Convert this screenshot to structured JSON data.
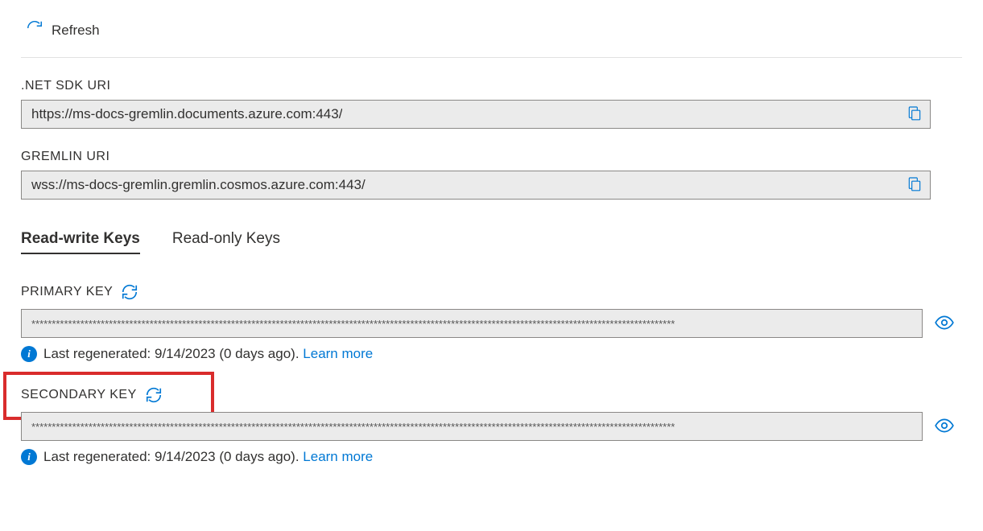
{
  "toolbar": {
    "refresh_label": "Refresh"
  },
  "uris": {
    "net_sdk": {
      "label": ".NET SDK URI",
      "value": "https://ms-docs-gremlin.documents.azure.com:443/"
    },
    "gremlin": {
      "label": "GREMLIN URI",
      "value": "wss://ms-docs-gremlin.gremlin.cosmos.azure.com:443/"
    }
  },
  "tabs": {
    "readwrite": "Read-write Keys",
    "readonly": "Read-only Keys"
  },
  "keys": {
    "primary": {
      "label": "PRIMARY KEY",
      "masked": "**************************************************************************************************************************************************************",
      "info_prefix": "Last regenerated: ",
      "info_date": "9/14/2023 (0 days ago). ",
      "learn_more": "Learn more"
    },
    "secondary": {
      "label": "SECONDARY KEY",
      "masked": "**************************************************************************************************************************************************************",
      "info_prefix": "Last regenerated: ",
      "info_date": "9/14/2023 (0 days ago). ",
      "learn_more": "Learn more"
    }
  }
}
